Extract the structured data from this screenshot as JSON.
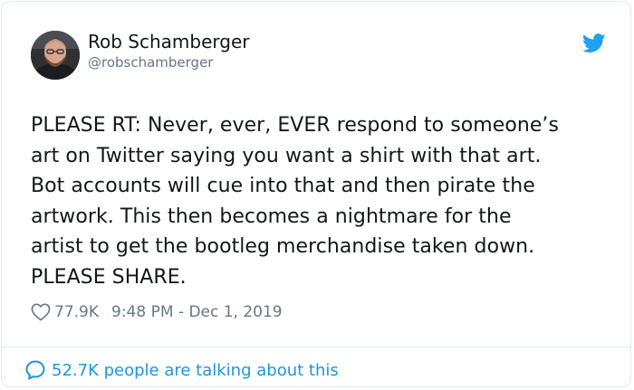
{
  "user": {
    "name": "Rob Schamberger",
    "handle": "@robschamberger"
  },
  "tweet": {
    "text": "PLEASE RT: Never, ever, EVER respond to someone’s\nart on Twitter saying you want a shirt with that art.\nBot accounts will cue into that and then pirate the\nartwork. This then becomes a nightmare for the\nartist to get the bootleg merchandise taken down.\nPLEASE SHARE."
  },
  "meta": {
    "likes": "77.9K",
    "timestamp": "9:48 PM - Dec 1, 2019"
  },
  "footer": {
    "talking": "52.7K people are talking about this"
  },
  "icons": {
    "brand": "twitter-bird-icon",
    "like": "heart-icon",
    "reply": "speech-bubble-icon"
  },
  "colors": {
    "brand": "#1da1f2",
    "secondary_text": "#657786",
    "link": "#1b95e0",
    "border": "#e1e8ed"
  }
}
